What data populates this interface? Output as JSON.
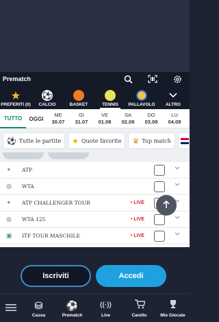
{
  "header": {
    "title": "Prematch",
    "icons": [
      "search-icon",
      "qr-scan-icon",
      "settings-icon"
    ]
  },
  "sports": [
    {
      "label": "PREFERITI (0)",
      "icon": "star-icon",
      "glyph": "★",
      "color": "#f5c518"
    },
    {
      "label": "CALCIO",
      "icon": "soccer-ball-icon",
      "glyph": "⚽",
      "color": "#ffffff"
    },
    {
      "label": "BASKET",
      "icon": "basketball-icon",
      "glyph": "●",
      "color": "#f07b22"
    },
    {
      "label": "TENNIS",
      "icon": "tennis-ball-icon",
      "glyph": "●",
      "color": "#e8e35a"
    },
    {
      "label": "PALLAVOLO",
      "icon": "volleyball-icon",
      "glyph": "●",
      "color": "#f1c24a"
    },
    {
      "label": "ALTRO",
      "icon": "chevron-down-icon",
      "glyph": "⌄",
      "color": "#ffffff"
    }
  ],
  "dates": {
    "tutto": "TUTTO",
    "oggi": "OGGI",
    "days": [
      {
        "day": "ME",
        "date": "30.07"
      },
      {
        "day": "GI",
        "date": "31.07"
      },
      {
        "day": "VE",
        "date": "01.08"
      },
      {
        "day": "SA",
        "date": "02.08"
      },
      {
        "day": "DO",
        "date": "03.08"
      },
      {
        "day": "LU",
        "date": "04.08"
      }
    ]
  },
  "chips": [
    {
      "label": "Tutte le partite",
      "icon": "soccer-ball-icon",
      "glyph": "⚽"
    },
    {
      "label": "Quote favorite",
      "icon": "star-icon",
      "glyph": "★"
    },
    {
      "label": "Top match",
      "icon": "trophy-icon",
      "glyph": "🏆"
    }
  ],
  "list": [
    {
      "name": "ATP",
      "live": "",
      "icon": "atp-icon",
      "color": "#6aa86a"
    },
    {
      "name": "WTA",
      "live": "",
      "icon": "wta-icon",
      "color": "#7b2e8a"
    },
    {
      "name": "ATP CHALLENGER TOUR",
      "live": "• LIVE",
      "icon": "atp-icon",
      "color": "#6aa86a"
    },
    {
      "name": "WTA 125",
      "live": "• LIVE",
      "icon": "wta-icon",
      "color": "#7b2e8a"
    },
    {
      "name": "ITF TOUR MASCHILE",
      "live": "• LIVE",
      "icon": "itf-icon",
      "color": "#4aa06a"
    }
  ],
  "auth": {
    "register": "Iscriviti",
    "login": "Accedi"
  },
  "bottom_nav": [
    {
      "label": "Cassa",
      "icon": "coins-icon",
      "glyph": "⛁"
    },
    {
      "label": "Prematch",
      "icon": "soccer-ball-icon",
      "glyph": "⚽"
    },
    {
      "label": "Live",
      "icon": "live-signal-icon",
      "glyph": "((·))"
    },
    {
      "label": "Carello",
      "icon": "cart-icon",
      "glyph": "🛒"
    },
    {
      "label": "Mie Giocate",
      "icon": "trophy-icon",
      "glyph": "🏆"
    }
  ]
}
